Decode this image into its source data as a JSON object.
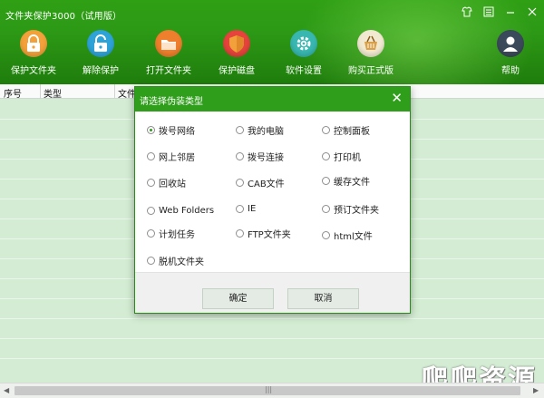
{
  "app": {
    "title": "文件夹保护3000（试用版）",
    "accent": "#2f9e1b"
  },
  "window_controls": [
    {
      "name": "skin-icon",
      "glyph": "♕"
    },
    {
      "name": "settings-icon",
      "glyph": "☰"
    },
    {
      "name": "minimize-icon",
      "glyph": "—"
    },
    {
      "name": "close-icon",
      "glyph": "✕"
    }
  ],
  "toolbar": {
    "protect_folder": "保护文件夹",
    "remove_protection": "解除保护",
    "open_folder": "打开文件夹",
    "protect_disk": "保护磁盘",
    "software_settings": "软件设置",
    "buy_full": "购买正式版",
    "help": "帮助"
  },
  "table": {
    "columns": [
      "序号",
      "类型",
      "文件"
    ]
  },
  "dialog": {
    "title": "请选择伪装类型",
    "options": [
      "拨号网络",
      "我的电脑",
      "控制面板",
      "网上邻居",
      "拨号连接",
      "打印机",
      "回收站",
      "CAB文件",
      "缓存文件",
      "Web Folders",
      "IE",
      "预订文件夹",
      "计划任务",
      "FTP文件夹",
      "html文件",
      "脱机文件夹"
    ],
    "selected": "拨号网络",
    "ok": "确定",
    "cancel": "取消"
  },
  "watermark": "爬爬资源"
}
